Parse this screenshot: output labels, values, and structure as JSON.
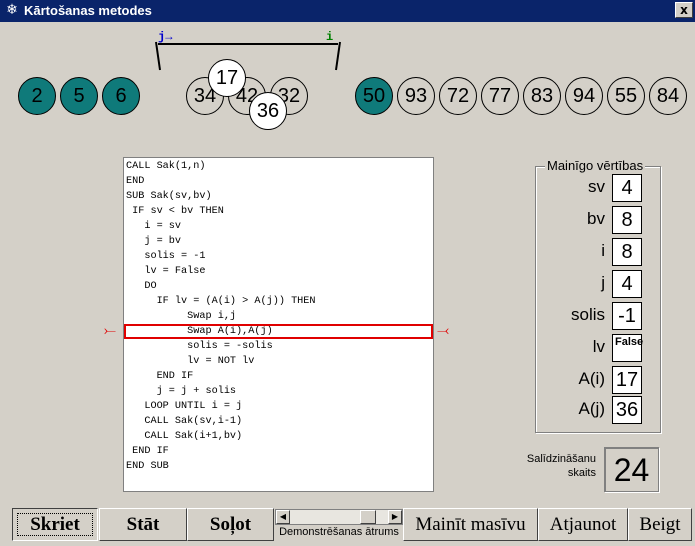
{
  "window": {
    "title": "Kārtošanas metodes",
    "close_label": "x",
    "title_icon": "snowflake-icon"
  },
  "pointers": {
    "j_label": "j→",
    "i_label": "i",
    "j_color": "#0000cc",
    "i_color": "#008000"
  },
  "array": {
    "left_sorted": [
      "2",
      "5",
      "6"
    ],
    "middle": [
      "34",
      "42",
      "32"
    ],
    "right_sorted_first": "50",
    "right": [
      "93",
      "72",
      "77",
      "83",
      "94",
      "55",
      "84"
    ],
    "compared_top": "17",
    "compared_bottom": "36",
    "teal_color": "#0f7a7a"
  },
  "code": {
    "lines": [
      "CALL Sak(1,n)",
      "END",
      "SUB Sak(sv,bv)",
      " IF sv < bv THEN",
      "   i = sv",
      "   j = bv",
      "   solis = -1",
      "   lv = False",
      "   DO",
      "     IF lv = (A(i) > A(j)) THEN",
      "          Swap i,j",
      "          Swap A(i),A(j)",
      "          solis = -solis",
      "          lv = NOT lv",
      "     END IF",
      "     j = j + solis",
      "   LOOP UNTIL i = j",
      "   CALL Sak(sv,i-1)",
      "   CALL Sak(i+1,bv)",
      " END IF",
      "END SUB"
    ],
    "highlight_index": 11,
    "highlight_color": "#e00000"
  },
  "variables": {
    "title": "Mainīgo vērtības",
    "items": [
      {
        "name": "sv",
        "value": "4"
      },
      {
        "name": "bv",
        "value": "8"
      },
      {
        "name": "i",
        "value": "8"
      },
      {
        "name": "j",
        "value": "4"
      },
      {
        "name": "solis",
        "value": "-1"
      },
      {
        "name": "lv",
        "value": "False"
      },
      {
        "name": "A(i)",
        "value": "17"
      },
      {
        "name": "A(j)",
        "value": "36"
      }
    ]
  },
  "comparisons": {
    "label_line1": "Salīdzināšanu",
    "label_line2": "skaits",
    "value": "24"
  },
  "buttons": {
    "run": "Skriet",
    "stop": "Stāt",
    "step": "Soļot",
    "change_array": "Mainīt masīvu",
    "refresh": "Atjaunot",
    "quit": "Beigt"
  },
  "speed": {
    "label": "Demonstrēšanas ātrums",
    "level": 0.85
  }
}
